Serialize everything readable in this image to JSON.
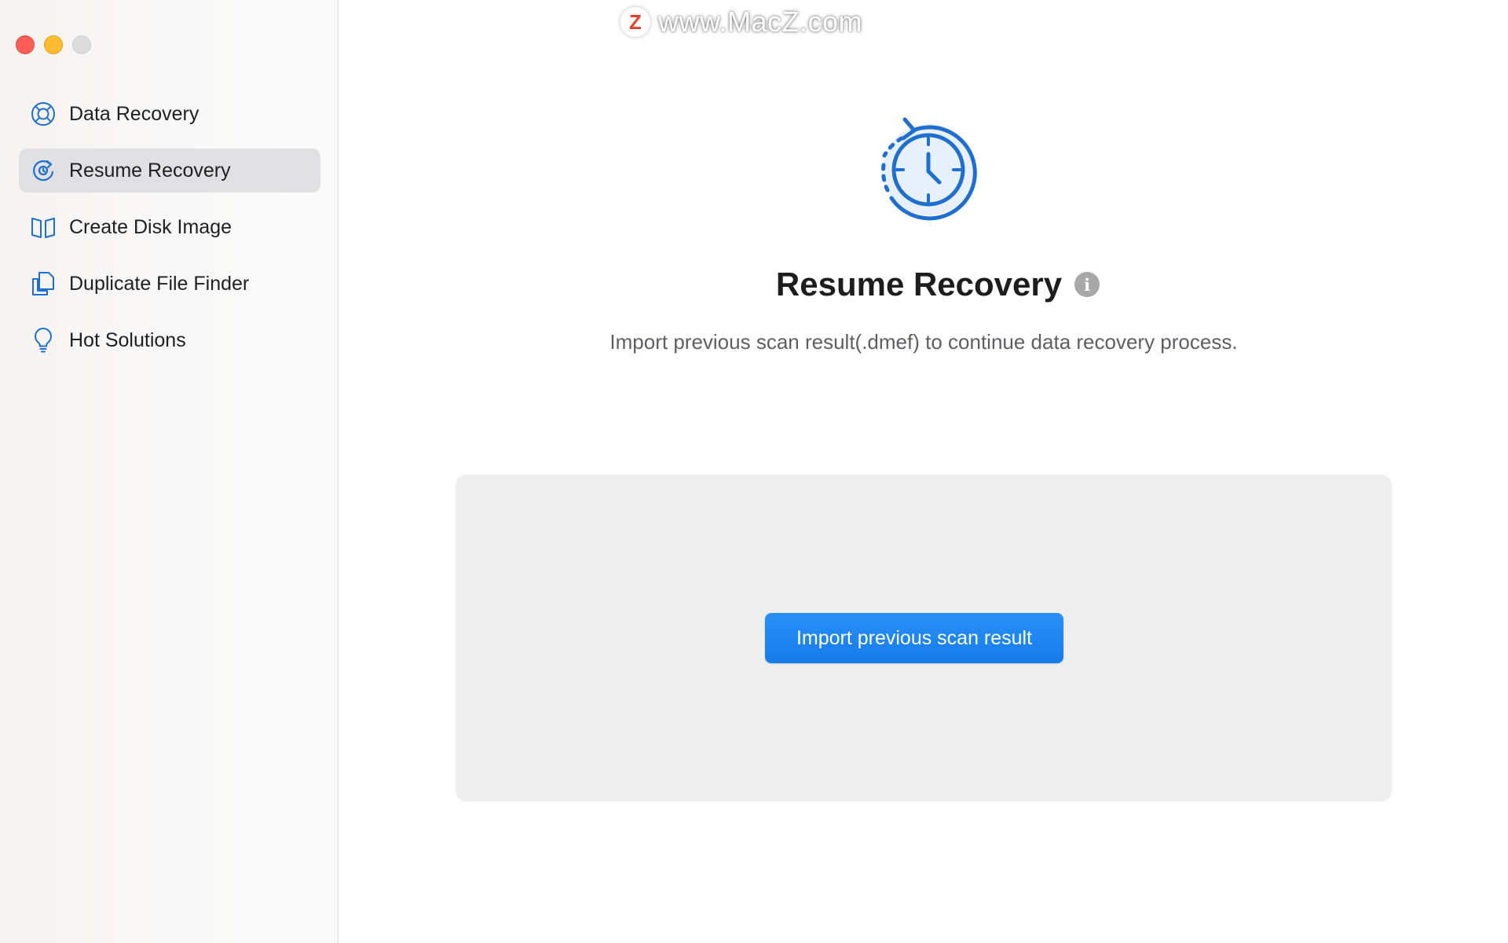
{
  "watermark": {
    "badge": "Z",
    "text": "www.MacZ.com"
  },
  "sidebar": {
    "items": [
      {
        "label": "Data Recovery",
        "icon": "lifebuoy-icon",
        "active": false
      },
      {
        "label": "Resume Recovery",
        "icon": "resume-icon",
        "active": true
      },
      {
        "label": "Create Disk Image",
        "icon": "disk-image-icon",
        "active": false
      },
      {
        "label": "Duplicate File Finder",
        "icon": "duplicate-file-icon",
        "active": false
      },
      {
        "label": "Hot Solutions",
        "icon": "lightbulb-icon",
        "active": false
      }
    ]
  },
  "main": {
    "title": "Resume Recovery",
    "info": "i",
    "subtitle": "Import previous scan result(.dmef) to continue data recovery process.",
    "import_button": "Import previous scan result"
  },
  "colors": {
    "accent": "#1a7ff0",
    "icon_blue": "#1e6fd0",
    "active_item_bg": "#e1e1e3",
    "panel_bg": "#efefef"
  }
}
